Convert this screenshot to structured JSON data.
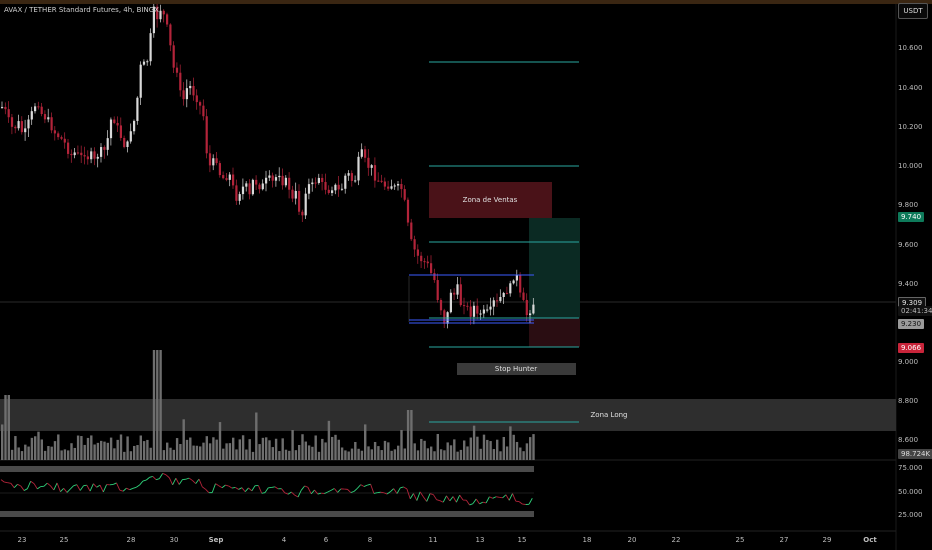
{
  "header": {
    "title": "AVAX / TETHER Standard Futures, 4h, BINGX",
    "currency": "USDT"
  },
  "price_axis": {
    "labels": [
      "10.600",
      "10.400",
      "10.200",
      "10.000",
      "9.800",
      "9.600",
      "9.400",
      "9.000",
      "8.800",
      "8.600"
    ]
  },
  "badges": {
    "target": "9.740",
    "last": "9.309",
    "countdown": "02:41:34",
    "entry": "9.230",
    "stop": "9.066",
    "volume": "98.724K"
  },
  "rsi_axis": {
    "labels": [
      "75.000",
      "50.000",
      "25.000"
    ]
  },
  "time_axis": {
    "labels": [
      "23",
      "25",
      "28",
      "30",
      "Sep",
      "4",
      "6",
      "8",
      "11",
      "13",
      "15",
      "18",
      "20",
      "22",
      "25",
      "27",
      "29",
      "Oct"
    ]
  },
  "annotations": {
    "sell_zone": "Zona de Ventas",
    "stop_hunter": "Stop Hunter",
    "long_zone": "Zona Long"
  },
  "colors": {
    "up": "#d9d9d9",
    "down": "#b3243a",
    "teal_line": "#2aa7a0",
    "blue_line": "#3c5bff",
    "sell_zone": "#4a1218",
    "target_badge": "#0e7a5a",
    "stop_badge": "#c8243a",
    "rsi": "#2fd17a"
  }
}
